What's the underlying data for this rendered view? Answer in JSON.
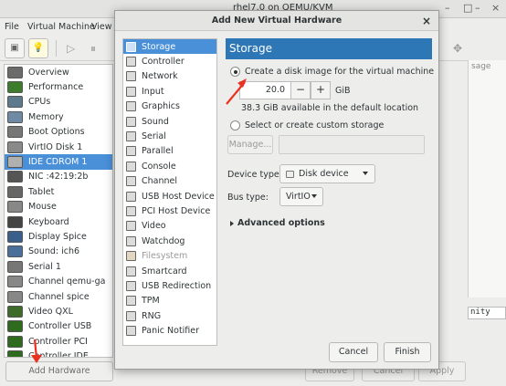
{
  "bg_window": {
    "title": "rhel7.0 on QEMU/KVM",
    "menu": [
      "File",
      "Virtual Machine",
      "View"
    ],
    "hardware": [
      {
        "label": "Overview",
        "icon": "overview-icon",
        "color": "#6b6b6b"
      },
      {
        "label": "Performance",
        "icon": "performance-icon",
        "color": "#3d7c2a"
      },
      {
        "label": "CPUs",
        "icon": "cpu-icon",
        "color": "#5d7a8c"
      },
      {
        "label": "Memory",
        "icon": "memory-icon",
        "color": "#6f8aa5"
      },
      {
        "label": "Boot Options",
        "icon": "gear-icon",
        "color": "#777777"
      },
      {
        "label": "VirtIO Disk 1",
        "icon": "disk-icon",
        "color": "#8a8a8a"
      },
      {
        "label": "IDE CDROM 1",
        "icon": "cdrom-icon",
        "color": "#b0b0b0"
      },
      {
        "label": "NIC :42:19:2b",
        "icon": "nic-icon",
        "color": "#555555"
      },
      {
        "label": "Tablet",
        "icon": "tablet-icon",
        "color": "#666666"
      },
      {
        "label": "Mouse",
        "icon": "mouse-icon",
        "color": "#888888"
      },
      {
        "label": "Keyboard",
        "icon": "keyboard-icon",
        "color": "#444444"
      },
      {
        "label": "Display Spice",
        "icon": "display-icon",
        "color": "#3a5f8a"
      },
      {
        "label": "Sound: ich6",
        "icon": "sound-icon",
        "color": "#4a6f9a"
      },
      {
        "label": "Serial 1",
        "icon": "serial-icon",
        "color": "#777777"
      },
      {
        "label": "Channel qemu-ga",
        "icon": "channel-icon",
        "color": "#888888"
      },
      {
        "label": "Channel spice",
        "icon": "channel-icon",
        "color": "#888888"
      },
      {
        "label": "Video QXL",
        "icon": "video-icon",
        "color": "#3d6b2a"
      },
      {
        "label": "Controller USB",
        "icon": "controller-icon",
        "color": "#2f6b1f"
      },
      {
        "label": "Controller PCI",
        "icon": "controller-icon",
        "color": "#2f6b1f"
      },
      {
        "label": "Controller IDE",
        "icon": "controller-icon",
        "color": "#2f6b1f"
      }
    ],
    "selected_index": 6,
    "add_hardware_label": "Add Hardware",
    "remove_label": "Remove",
    "cancel_label": "Cancel",
    "apply_label": "Apply",
    "right_text": "sage",
    "right_term": "nity"
  },
  "dialog": {
    "title": "Add New Virtual Hardware",
    "close_glyph": "×",
    "types": [
      {
        "label": "Storage",
        "icon": "storage-icon",
        "disabled": false
      },
      {
        "label": "Controller",
        "icon": "controller-icon",
        "disabled": false
      },
      {
        "label": "Network",
        "icon": "network-icon",
        "disabled": false
      },
      {
        "label": "Input",
        "icon": "input-icon",
        "disabled": false
      },
      {
        "label": "Graphics",
        "icon": "graphics-icon",
        "disabled": false
      },
      {
        "label": "Sound",
        "icon": "sound-icon",
        "disabled": false
      },
      {
        "label": "Serial",
        "icon": "serial-icon",
        "disabled": false
      },
      {
        "label": "Parallel",
        "icon": "parallel-icon",
        "disabled": false
      },
      {
        "label": "Console",
        "icon": "console-icon",
        "disabled": false
      },
      {
        "label": "Channel",
        "icon": "channel-icon",
        "disabled": false
      },
      {
        "label": "USB Host Device",
        "icon": "usb-icon",
        "disabled": false
      },
      {
        "label": "PCI Host Device",
        "icon": "pci-icon",
        "disabled": false
      },
      {
        "label": "Video",
        "icon": "video-icon",
        "disabled": false
      },
      {
        "label": "Watchdog",
        "icon": "watchdog-icon",
        "disabled": false
      },
      {
        "label": "Filesystem",
        "icon": "folder-icon",
        "disabled": true
      },
      {
        "label": "Smartcard",
        "icon": "smartcard-icon",
        "disabled": false
      },
      {
        "label": "USB Redirection",
        "icon": "usb-redirect-icon",
        "disabled": false
      },
      {
        "label": "TPM",
        "icon": "tpm-icon",
        "disabled": false
      },
      {
        "label": "RNG",
        "icon": "rng-icon",
        "disabled": false
      },
      {
        "label": "Panic Notifier",
        "icon": "panic-icon",
        "disabled": false
      }
    ],
    "selected_type": 0,
    "panel_title": "Storage",
    "create_image_label": "Create a disk image for the virtual machine",
    "size_value": "20.0",
    "minus": "−",
    "plus": "+",
    "size_unit": "GiB",
    "available": "38.3 GiB available in the default location",
    "custom_storage_label": "Select or create custom storage",
    "manage_label": "Manage...",
    "device_type_label": "Device type:",
    "device_type_value": "Disk device",
    "bus_type_label": "Bus type:",
    "bus_type_value": "VirtIO",
    "advanced_label": "Advanced options",
    "cancel_label": "Cancel",
    "finish_label": "Finish"
  },
  "colors": {
    "selection": "#4a90d9",
    "panel_header": "#2e77b6",
    "annotation_arrow": "#e8321e"
  }
}
